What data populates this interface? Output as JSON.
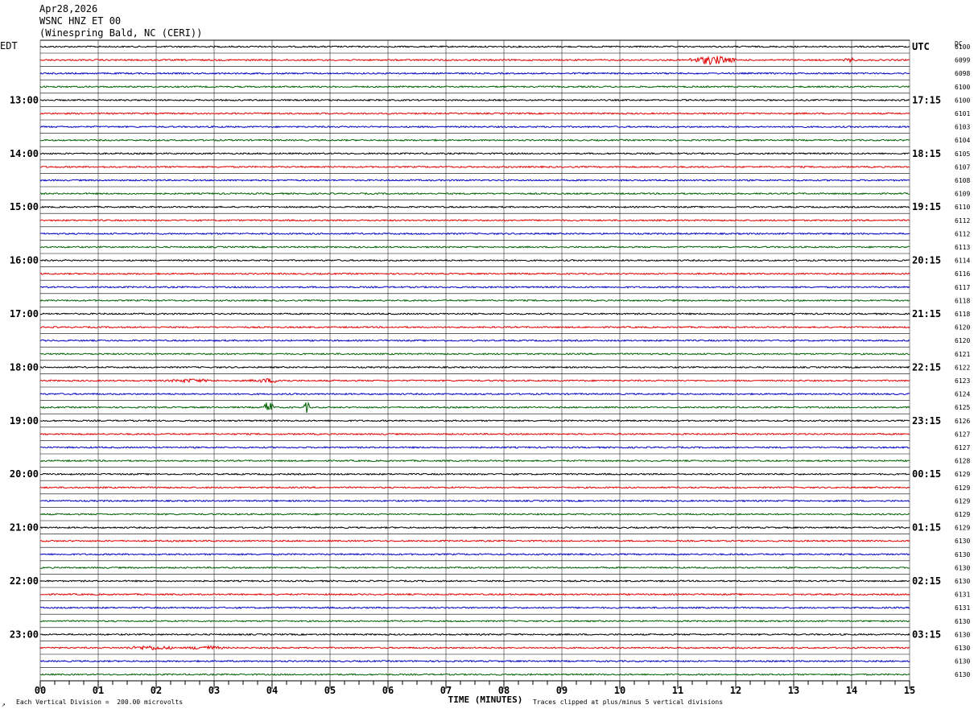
{
  "header": {
    "date": "Apr28,2026",
    "station": "WSNC HNZ ET 00",
    "location": "(Winespring Bald, NC (CERI))"
  },
  "left_tz": "EDT",
  "right_tz": "UTC",
  "dc_label": "DC",
  "footer": {
    "scale_note": "Each Vertical Division =  200.00 microvolts",
    "clip_note": "Traces clipped at plus/minus 5 vertical divisions",
    "corner_mark": "↗"
  },
  "colors": {
    "cycle": [
      "#000000",
      "#e00000",
      "#0000c0",
      "#006000"
    ],
    "grid": "#808080"
  },
  "chart_data": {
    "type": "line",
    "title": "",
    "xlabel": "TIME (MINUTES)",
    "xlim": [
      0,
      15
    ],
    "x_ticks": [
      "00",
      "01",
      "02",
      "03",
      "04",
      "05",
      "06",
      "07",
      "08",
      "09",
      "10",
      "11",
      "12",
      "13",
      "14",
      "15"
    ],
    "trace_count": 48,
    "left_hour_labels": [
      {
        "trace": 4,
        "label": "13:00"
      },
      {
        "trace": 8,
        "label": "14:00"
      },
      {
        "trace": 12,
        "label": "15:00"
      },
      {
        "trace": 16,
        "label": "16:00"
      },
      {
        "trace": 20,
        "label": "17:00"
      },
      {
        "trace": 24,
        "label": "18:00"
      },
      {
        "trace": 28,
        "label": "19:00"
      },
      {
        "trace": 32,
        "label": "20:00"
      },
      {
        "trace": 36,
        "label": "21:00"
      },
      {
        "trace": 40,
        "label": "22:00"
      },
      {
        "trace": 44,
        "label": "23:00"
      }
    ],
    "right_hour_labels": [
      {
        "trace": 0,
        "label": "UTC"
      },
      {
        "trace": 4,
        "label": "17:15"
      },
      {
        "trace": 8,
        "label": "18:15"
      },
      {
        "trace": 12,
        "label": "19:15"
      },
      {
        "trace": 16,
        "label": "20:15"
      },
      {
        "trace": 20,
        "label": "21:15"
      },
      {
        "trace": 24,
        "label": "22:15"
      },
      {
        "trace": 28,
        "label": "23:15"
      },
      {
        "trace": 32,
        "label": "00:15"
      },
      {
        "trace": 36,
        "label": "01:15"
      },
      {
        "trace": 40,
        "label": "02:15"
      },
      {
        "trace": 44,
        "label": "03:15"
      }
    ],
    "dc_offsets": [
      "6100",
      "6099",
      "6098",
      "6100",
      "6100",
      "6101",
      "6103",
      "6104",
      "6105",
      "6107",
      "6108",
      "6109",
      "6110",
      "6112",
      "6112",
      "6113",
      "6114",
      "6116",
      "6117",
      "6118",
      "6118",
      "6120",
      "6120",
      "6121",
      "6122",
      "6123",
      "6124",
      "6125",
      "6126",
      "6127",
      "6127",
      "6128",
      "6129",
      "6129",
      "6129",
      "6129",
      "6129",
      "6130",
      "6130",
      "6130",
      "6130",
      "6131",
      "6131",
      "6130",
      "6130",
      "6130",
      "6130",
      "6130"
    ],
    "events": [
      {
        "trace": 1,
        "start_min": 11.2,
        "end_min": 12.0,
        "amp": 6
      },
      {
        "trace": 1,
        "start_min": 13.85,
        "end_min": 14.1,
        "amp": 3
      },
      {
        "trace": 25,
        "start_min": 2.1,
        "end_min": 3.1,
        "amp": 2.5
      },
      {
        "trace": 25,
        "start_min": 3.6,
        "end_min": 4.3,
        "amp": 3
      },
      {
        "trace": 27,
        "start_min": 3.85,
        "end_min": 4.05,
        "amp": 9
      },
      {
        "trace": 27,
        "start_min": 4.55,
        "end_min": 4.65,
        "amp": 8
      },
      {
        "trace": 45,
        "start_min": 1.4,
        "end_min": 2.4,
        "amp": 3
      },
      {
        "trace": 45,
        "start_min": 2.5,
        "end_min": 3.2,
        "amp": 3
      }
    ]
  }
}
